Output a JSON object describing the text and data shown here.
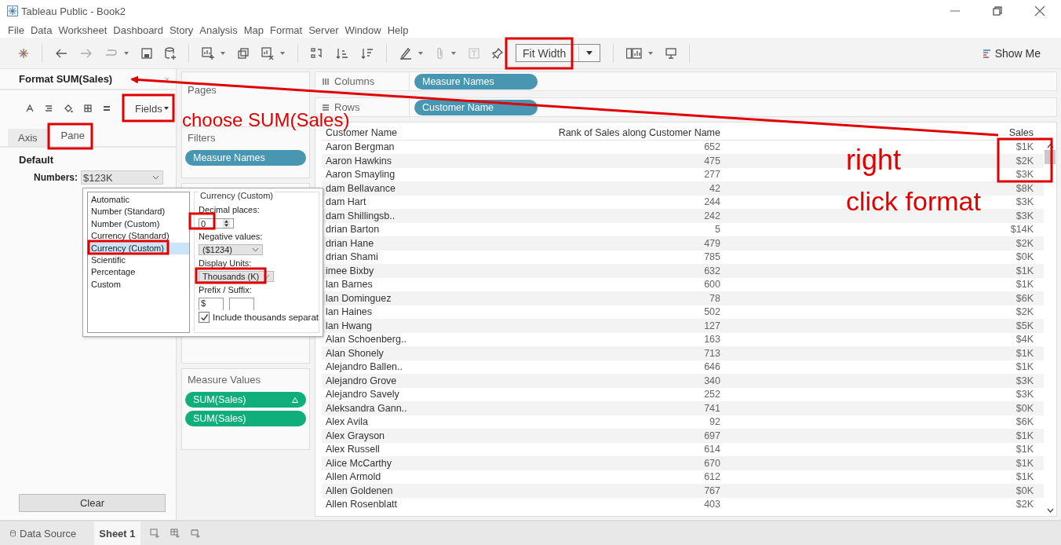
{
  "window": {
    "title": "Tableau Public - Book2"
  },
  "menu": [
    "File",
    "Data",
    "Worksheet",
    "Dashboard",
    "Story",
    "Analysis",
    "Map",
    "Format",
    "Server",
    "Window",
    "Help"
  ],
  "toolbar": {
    "fit": "Fit Width",
    "show_me": "Show Me"
  },
  "format_pane": {
    "title": "Format SUM(Sales)",
    "close": "×",
    "fields": "Fields",
    "tabs": [
      {
        "label": "Axis",
        "selected": false
      },
      {
        "label": "Pane",
        "selected": true
      }
    ],
    "section": "Default",
    "numbers_label": "Numbers:",
    "numbers_value": "$123K",
    "clear": "Clear"
  },
  "format_popup": {
    "types": [
      {
        "label": "Automatic",
        "selected": false
      },
      {
        "label": "Number (Standard)",
        "selected": false
      },
      {
        "label": "Number (Custom)",
        "selected": false
      },
      {
        "label": "Currency (Standard)",
        "selected": false
      },
      {
        "label": "Currency (Custom)",
        "selected": true
      },
      {
        "label": "Scientific",
        "selected": false
      },
      {
        "label": "Percentage",
        "selected": false
      },
      {
        "label": "Custom",
        "selected": false
      }
    ],
    "group_title": "Currency (Custom)",
    "decimal_label": "Decimal places:",
    "decimal_value": "0",
    "negative_label": "Negative values:",
    "negative_value": "($1234)",
    "units_label": "Display Units:",
    "units_value": "Thousands (K)",
    "prefix_label": "Prefix / Suffix:",
    "prefix": "$",
    "separator": {
      "label": "Include thousands separat",
      "checked": true
    }
  },
  "cards": {
    "pages": "Pages",
    "filters": {
      "title": "Filters",
      "pills": [
        "Measure Names"
      ]
    },
    "measure_values": {
      "title": "Measure Values",
      "pills": [
        {
          "label": "SUM(Sales)",
          "delta": true
        },
        {
          "label": "SUM(Sales)",
          "delta": false
        }
      ]
    }
  },
  "shelves": [
    {
      "kind": "columns",
      "label": "Columns",
      "pill": "Measure Names"
    },
    {
      "kind": "rows",
      "label": "Rows",
      "pill": "Customer Name"
    }
  ],
  "table": {
    "columns": [
      "Customer Name",
      "Rank of Sales along Customer Name",
      "Sales"
    ],
    "rows": [
      [
        "Aaron Bergman",
        "652",
        "$1K"
      ],
      [
        "Aaron Hawkins",
        "475",
        "$2K"
      ],
      [
        "Aaron Smayling",
        "277",
        "$3K"
      ],
      [
        "dam Bellavance",
        "42",
        "$8K"
      ],
      [
        "dam Hart",
        "244",
        "$3K"
      ],
      [
        "dam Shillingsb..",
        "242",
        "$3K"
      ],
      [
        "drian Barton",
        "5",
        "$14K"
      ],
      [
        "drian Hane",
        "479",
        "$2K"
      ],
      [
        "drian Shami",
        "785",
        "$0K"
      ],
      [
        "imee Bixby",
        "632",
        "$1K"
      ],
      [
        "lan Barnes",
        "600",
        "$1K"
      ],
      [
        "lan Dominguez",
        "78",
        "$6K"
      ],
      [
        "lan Haines",
        "502",
        "$2K"
      ],
      [
        "lan Hwang",
        "127",
        "$5K"
      ],
      [
        "Alan Schoenberg..",
        "163",
        "$4K"
      ],
      [
        "Alan Shonely",
        "713",
        "$1K"
      ],
      [
        "Alejandro Ballen..",
        "646",
        "$1K"
      ],
      [
        "Alejandro Grove",
        "340",
        "$3K"
      ],
      [
        "Alejandro Savely",
        "252",
        "$3K"
      ],
      [
        "Aleksandra Gann..",
        "741",
        "$0K"
      ],
      [
        "Alex Avila",
        "92",
        "$6K"
      ],
      [
        "Alex Grayson",
        "697",
        "$1K"
      ],
      [
        "Alex Russell",
        "614",
        "$1K"
      ],
      [
        "Alice McCarthy",
        "670",
        "$1K"
      ],
      [
        "Allen Armold",
        "612",
        "$1K"
      ],
      [
        "Allen Goldenen",
        "767",
        "$0K"
      ],
      [
        "Allen Rosenblatt",
        "403",
        "$2K"
      ]
    ]
  },
  "sheet_tabs": [
    {
      "label": "Data Source",
      "selected": false
    },
    {
      "label": "Sheet 1",
      "selected": true
    }
  ],
  "annotations": [
    {
      "kind": "caption",
      "text": "choose SUM(Sales)"
    },
    {
      "kind": "side",
      "text": "right"
    },
    {
      "kind": "side2",
      "text": "click format"
    }
  ]
}
